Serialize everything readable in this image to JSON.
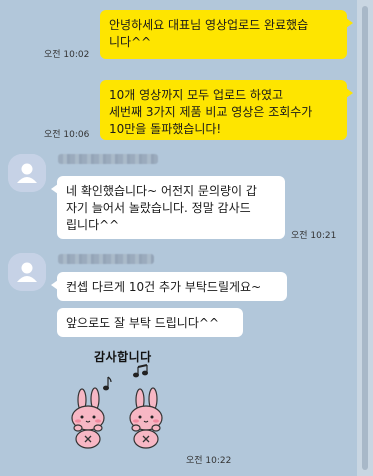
{
  "messages_me": [
    {
      "text": "안녕하세요 대표님 영상업로드 완료했습\n니다^^",
      "time": "오전 10:02"
    },
    {
      "text": "10개 영상까지 모두 업로드 하였고\n세번째 3가지 제품 비교 영상은 조회수가\n10만을 돌파했습니다!",
      "time": "오전 10:06"
    }
  ],
  "messages_other": [
    {
      "text": "네 확인했습니다~ 어전지 문의량이 갑\n자기 늘어서 놀랐습니다. 정말 감사드\n립니다^^",
      "time": "오전 10:21"
    },
    {
      "text": "컨셉 다르게 10건 추가 부탁드릴게요~",
      "time": ""
    },
    {
      "text": "앞으로도 잘 부탁 드립니다^^",
      "time": ""
    }
  ],
  "sticker": {
    "caption": "감사합니다",
    "time": "오전 10:22",
    "icon": "rabbit-thanks-sticker"
  },
  "colors": {
    "background": "#b2c7da",
    "my_bubble": "#fee500",
    "other_bubble": "#ffffff"
  }
}
